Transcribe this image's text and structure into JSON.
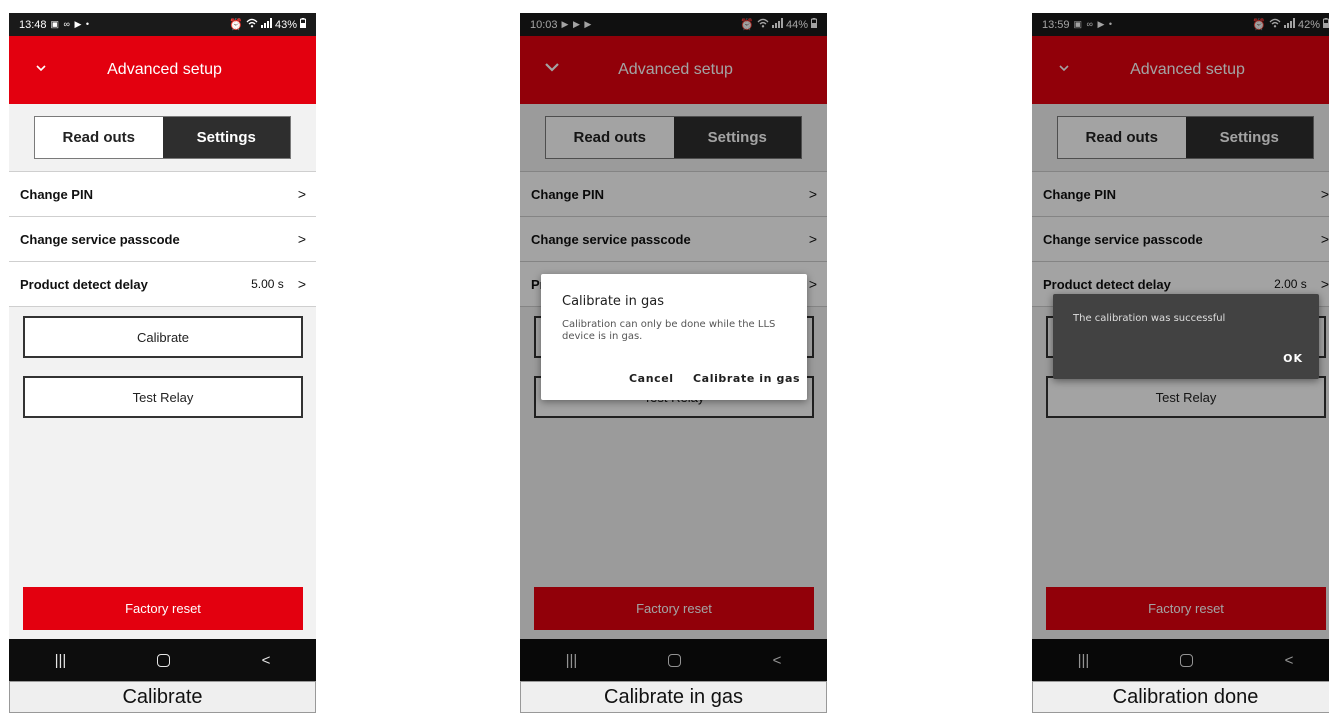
{
  "app": {
    "title": "Advanced setup",
    "tabs": {
      "readouts": "Read outs",
      "settings": "Settings"
    },
    "rows": {
      "change_pin": "Change PIN",
      "change_service_passcode": "Change service passcode",
      "product_detect_delay": "Product detect delay"
    },
    "buttons": {
      "calibrate": "Calibrate",
      "test_relay": "Test Relay",
      "factory_reset": "Factory reset"
    },
    "arrow": ">"
  },
  "colors": {
    "brand_red": "#e3000f",
    "active_tab": "#2e2e2e",
    "toast_bg": "#424242"
  },
  "screens": [
    {
      "status": {
        "time": "13:48",
        "icons": "▣ ∞ ▶ •",
        "battery": "43%"
      },
      "delay_value": "5.00 s",
      "caption": "Calibrate"
    },
    {
      "status": {
        "time": "10:03",
        "icons": "▶ ▶ ▶",
        "battery": "44%"
      },
      "dialog": {
        "title": "Calibrate in gas",
        "message": "Calibration can only be done while the LLS device is in gas.",
        "cancel": "Cancel",
        "confirm": "Calibrate in gas"
      },
      "caption": "Calibrate in gas"
    },
    {
      "status": {
        "time": "13:59",
        "icons": "▣ ∞ ▶ •",
        "battery": "42%"
      },
      "delay_value": "2.00 s",
      "toast": {
        "message": "The calibration was successful",
        "ok": "OK"
      },
      "caption": "Calibration done"
    }
  ]
}
